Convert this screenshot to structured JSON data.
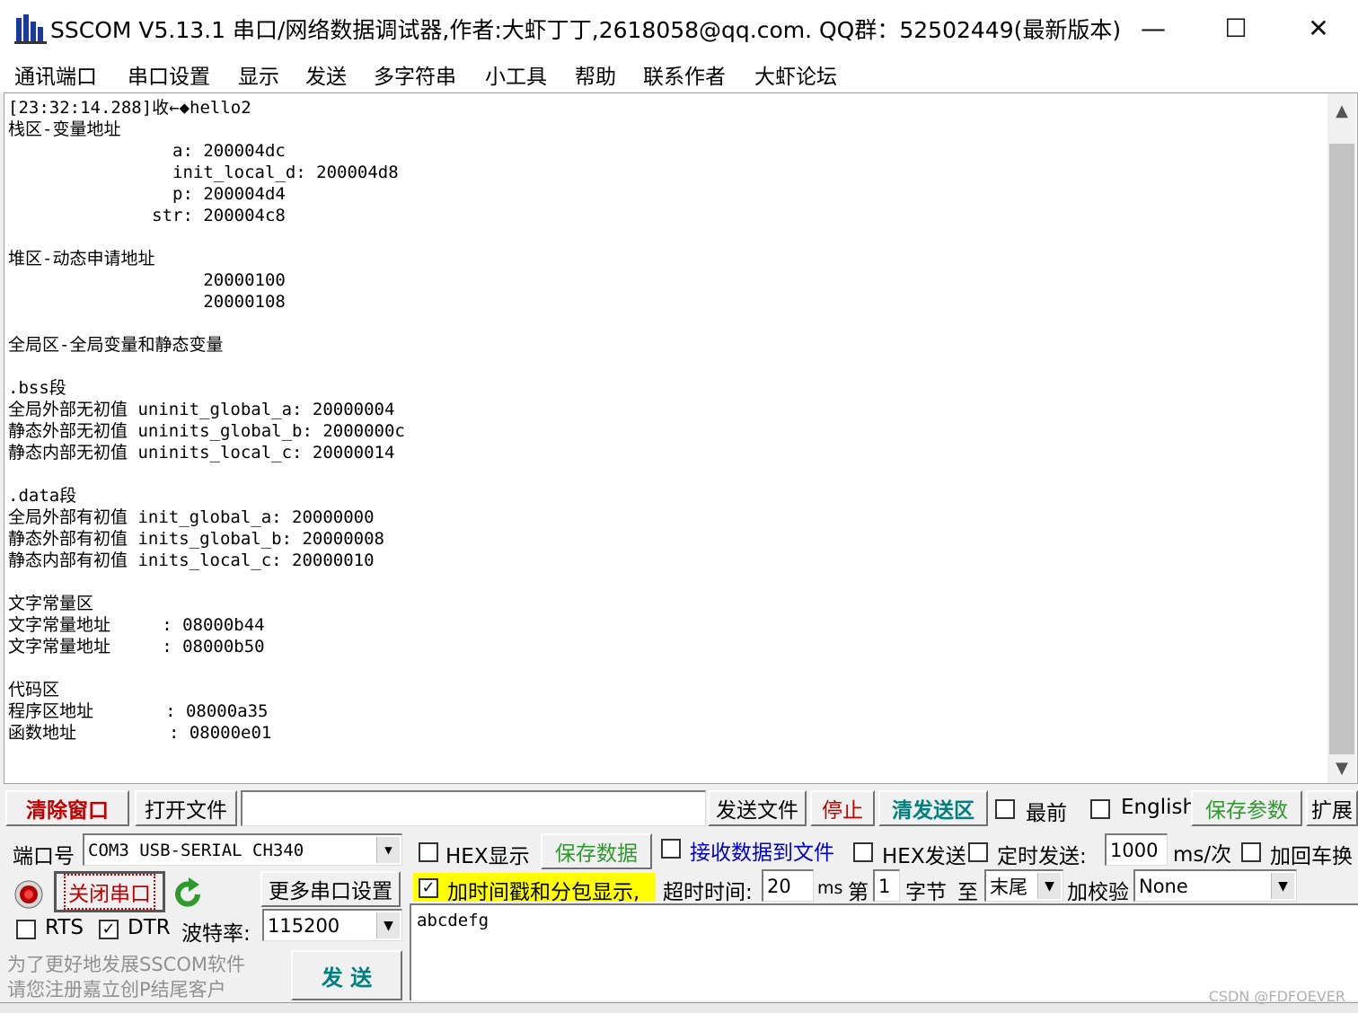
{
  "window": {
    "title": "SSCOM V5.13.1 串口/网络数据调试器,作者:大虾丁丁,2618058@qq.com. QQ群：52502449(最新版本)",
    "minimize": "—",
    "maximize": "☐",
    "close": "✕"
  },
  "menu": [
    "通讯端口",
    "串口设置",
    "显示",
    "发送",
    "多字符串",
    "小工具",
    "帮助",
    "联系作者",
    "大虾论坛"
  ],
  "receive": {
    "text": "[23:32:14.288]收←◆hello2\n栈区-变量地址\n                a: 200004dc\n                init_local_d: 200004d8\n                p: 200004d4\n              str: 200004c8\n\n堆区-动态申请地址\n                   20000100\n                   20000108\n\n全局区-全局变量和静态变量\n\n.bss段\n全局外部无初值 uninit_global_a: 20000004\n静态外部无初值 uninits_global_b: 2000000c\n静态内部无初值 uninits_local_c: 20000014\n\n.data段\n全局外部有初值 init_global_a: 20000000\n静态外部有初值 inits_global_b: 20000008\n静态内部有初值 inits_local_c: 20000010\n\n文字常量区\n文字常量地址     : 08000b44\n文字常量地址     : 08000b50\n\n代码区\n程序区地址       : 08000a35\n函数地址         : 08000e01"
  },
  "toolbar": {
    "clear_window": "清除窗口",
    "open_file": "打开文件",
    "file_path": "",
    "send_file": "发送文件",
    "stop": "停止",
    "clear_send": "清发送区",
    "topmost": "最前",
    "english": "English",
    "save_params": "保存参数",
    "expand": "扩展"
  },
  "port": {
    "port_label": "端口号",
    "port_value": "COM3 USB-SERIAL CH340",
    "close_port": "关闭串口",
    "more_settings": "更多串口设置",
    "rts": "RTS",
    "dtr": "DTR",
    "baud_label": "波特率:",
    "baud_value": "115200",
    "promo_line1": "为了更好地发展SSCOM软件",
    "promo_line2": "请您注册嘉立创P结尾客户",
    "send_button": "发 送"
  },
  "options": {
    "hex_display": "HEX显示",
    "save_data": "保存数据",
    "recv_to_file": "接收数据到文件",
    "hex_send": "HEX发送",
    "timed_send": "定时发送:",
    "interval_value": "1000",
    "interval_unit": "ms/次",
    "add_crlf": "加回车换",
    "timestamp": "加时间戳和分包显示,",
    "timeout_label": "超时时间:",
    "timeout_value": "20",
    "timeout_unit": "ms",
    "byte_from_label": "第",
    "byte_from_value": "1",
    "byte_unit": "字节",
    "to_label": "至",
    "to_value": "末尾",
    "checksum_label": "加校验",
    "checksum_value": "None"
  },
  "send": {
    "text": "abcdefg"
  },
  "watermark": "CSDN @FDFOEVER",
  "colors": {
    "red_label": "#c00000",
    "teal_label": "#007f7f",
    "blue_label": "#0000c0",
    "highlight": "#ffff00",
    "green_icon": "#2e9a2e"
  }
}
